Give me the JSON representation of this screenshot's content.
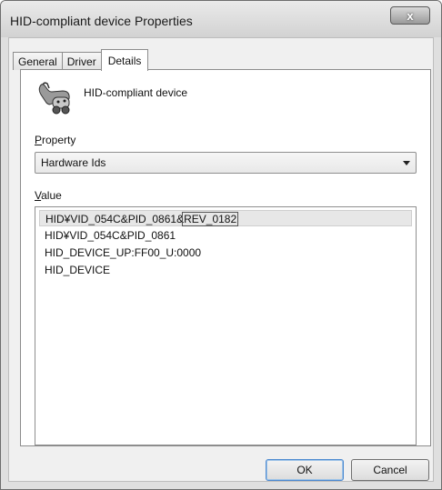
{
  "window": {
    "title": "HID-compliant device Properties",
    "close_label": "x"
  },
  "tabs": [
    {
      "label": "General",
      "active": false
    },
    {
      "label": "Driver",
      "active": false
    },
    {
      "label": "Details",
      "active": true
    }
  ],
  "device": {
    "name": "HID-compliant device",
    "icon": "game-controller-icon"
  },
  "property": {
    "label_accel": "P",
    "label_rest": "roperty",
    "selected_value": "Hardware Ids"
  },
  "value": {
    "label_accel": "V",
    "label_rest": "alue",
    "items": [
      {
        "text_prefix": "HID¥VID_054C&PID_0861&",
        "text_focus": "REV_0182",
        "selected": true
      },
      {
        "text": "HID¥VID_054C&PID_0861"
      },
      {
        "text": "HID_DEVICE_UP:FF00_U:0000"
      },
      {
        "text": "HID_DEVICE"
      }
    ]
  },
  "buttons": {
    "ok": "OK",
    "cancel": "Cancel"
  }
}
